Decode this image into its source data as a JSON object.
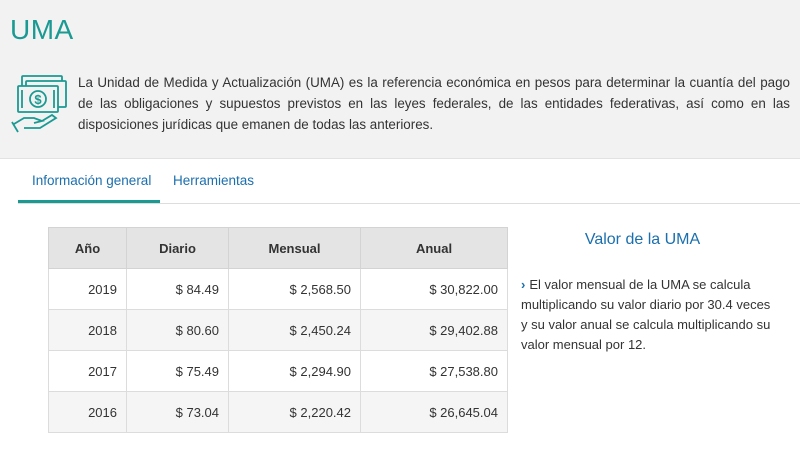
{
  "header": {
    "title": "UMA"
  },
  "intro": {
    "icon": "money-hand-icon",
    "accent": "#1a9a93",
    "text": "La Unidad de Medida y Actualización (UMA) es la referencia económica en pesos para determinar la cuantía del pago de las obligaciones y supuestos previstos en las leyes federales, de las entidades federativas, así como en las disposiciones jurídicas que emanen de todas las anteriores."
  },
  "tabs": [
    {
      "label": "Información general",
      "active": true
    },
    {
      "label": "Herramientas",
      "active": false
    }
  ],
  "table": {
    "headers": [
      "Año",
      "Diario",
      "Mensual",
      "Anual"
    ],
    "rows": [
      [
        "2019",
        "$ 84.49",
        "$ 2,568.50",
        "$ 30,822.00"
      ],
      [
        "2018",
        "$ 80.60",
        "$ 2,450.24",
        "$ 29,402.88"
      ],
      [
        "2017",
        "$ 75.49",
        "$ 2,294.90",
        "$ 27,538.80"
      ],
      [
        "2016",
        "$ 73.04",
        "$ 2,220.42",
        "$ 26,645.04"
      ]
    ]
  },
  "sidebar": {
    "title": "Valor de la UMA",
    "icon": "chevron-right-icon",
    "text": "El valor mensual de la UMA se calcula multiplicando su valor diario por 30.4 veces y su valor anual se calcula multiplicando su valor mensual por 12."
  }
}
